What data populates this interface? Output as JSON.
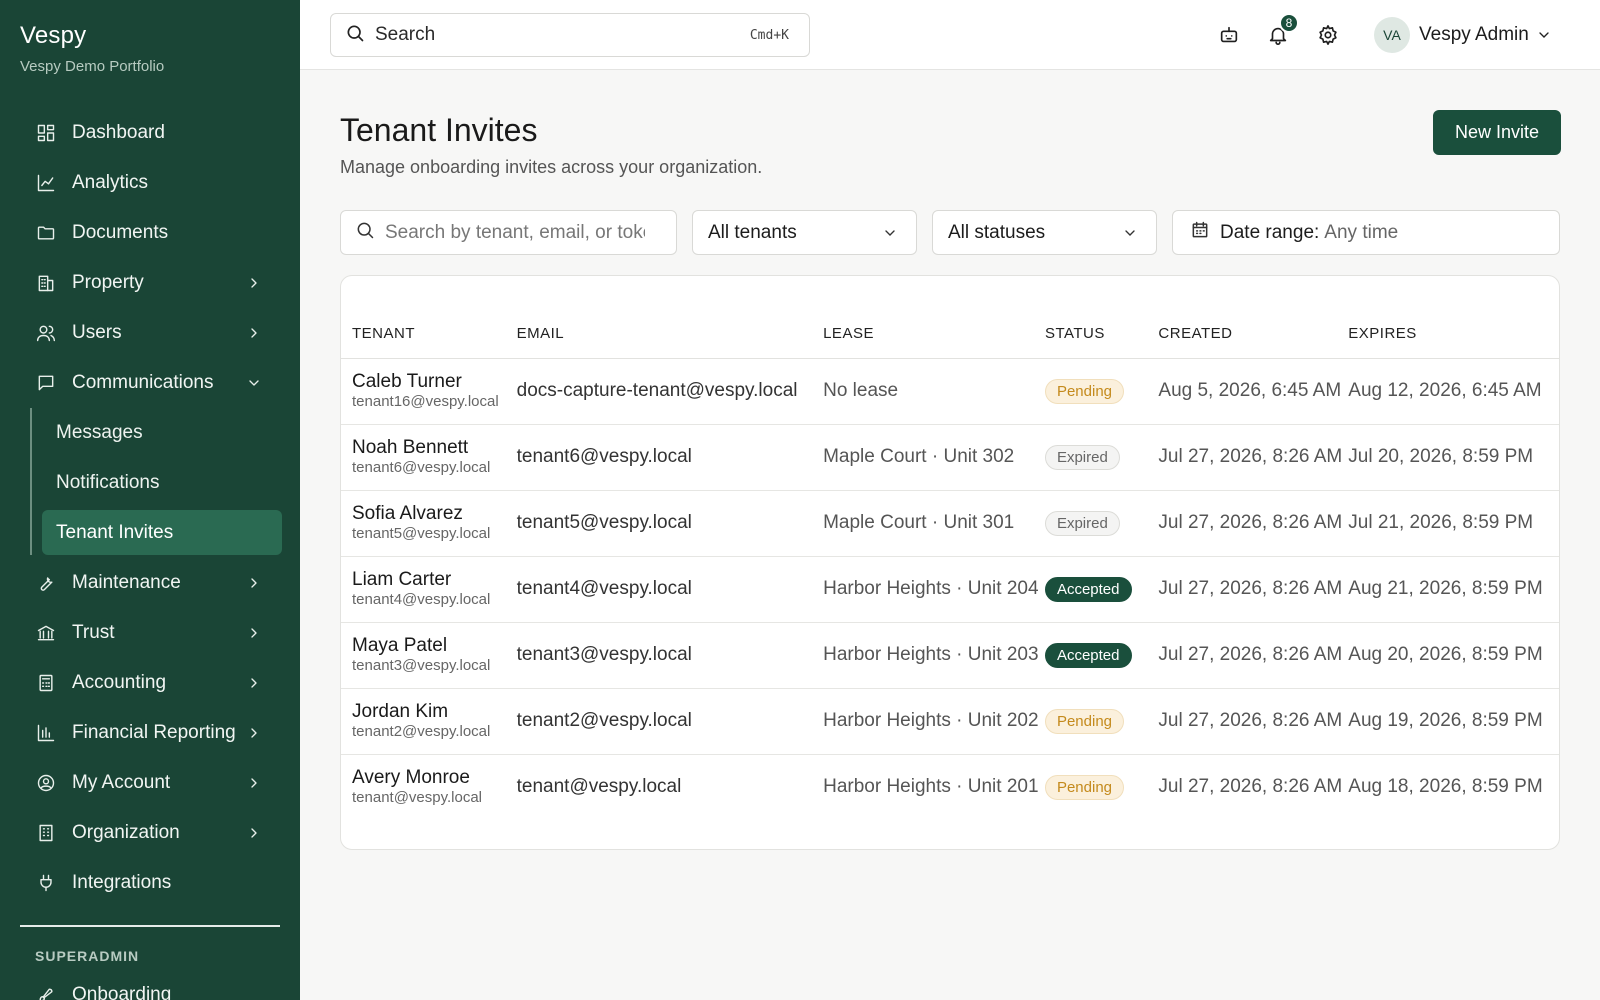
{
  "brand": {
    "name": "Vespy",
    "portfolio": "Vespy Demo Portfolio"
  },
  "sidebar": {
    "items": [
      {
        "label": "Dashboard",
        "icon": "dashboard-icon"
      },
      {
        "label": "Analytics",
        "icon": "chart-line-icon"
      },
      {
        "label": "Documents",
        "icon": "folder-icon"
      },
      {
        "label": "Property",
        "icon": "building-icon",
        "has_children": true
      },
      {
        "label": "Users",
        "icon": "users-icon",
        "has_children": true
      },
      {
        "label": "Communications",
        "icon": "message-square-icon",
        "expanded": true
      },
      {
        "label": "Maintenance",
        "icon": "wrench-icon",
        "has_children": true
      },
      {
        "label": "Trust",
        "icon": "bank-icon",
        "has_children": true
      },
      {
        "label": "Accounting",
        "icon": "calculator-icon",
        "has_children": true
      },
      {
        "label": "Financial Reporting",
        "icon": "bar-chart-icon",
        "has_children": true
      },
      {
        "label": "My Account",
        "icon": "user-circle-icon",
        "has_children": true
      },
      {
        "label": "Organization",
        "icon": "office-building-icon",
        "has_children": true
      },
      {
        "label": "Integrations",
        "icon": "plug-icon"
      }
    ],
    "communications_children": [
      {
        "label": "Messages"
      },
      {
        "label": "Notifications"
      },
      {
        "label": "Tenant Invites",
        "active": true
      }
    ],
    "section_label": "SUPERADMIN",
    "superadmin_items": [
      {
        "label": "Onboarding",
        "icon": "rocket-icon"
      }
    ]
  },
  "topbar": {
    "search_placeholder": "Search",
    "search_shortcut": "Cmd+K",
    "notification_count": "8",
    "user": {
      "initials": "VA",
      "name": "Vespy Admin"
    }
  },
  "page": {
    "title": "Tenant Invites",
    "subtitle": "Manage onboarding invites across your organization.",
    "new_invite_label": "New Invite"
  },
  "filters": {
    "search_placeholder": "Search by tenant, email, or token",
    "tenant_select": "All tenants",
    "status_select": "All statuses",
    "date_range_label": "Date range:",
    "date_range_value": "Any time"
  },
  "table": {
    "headers": [
      "TENANT",
      "EMAIL",
      "LEASE",
      "STATUS",
      "CREATED",
      "EXPIRES"
    ],
    "rows": [
      {
        "name": "Caleb Turner",
        "sub_email": "tenant16@vespy.local",
        "email": "docs-capture-tenant@vespy.local",
        "lease": "No lease",
        "status": "Pending",
        "status_kind": "pending",
        "created": "Aug 5, 2026, 6:45 AM",
        "expires": "Aug 12, 2026, 6:45 AM"
      },
      {
        "name": "Noah Bennett",
        "sub_email": "tenant6@vespy.local",
        "email": "tenant6@vespy.local",
        "lease": "Maple Court · Unit 302",
        "status": "Expired",
        "status_kind": "expired",
        "created": "Jul 27, 2026, 8:26 AM",
        "expires": "Jul 20, 2026, 8:59 PM"
      },
      {
        "name": "Sofia Alvarez",
        "sub_email": "tenant5@vespy.local",
        "email": "tenant5@vespy.local",
        "lease": "Maple Court · Unit 301",
        "status": "Expired",
        "status_kind": "expired",
        "created": "Jul 27, 2026, 8:26 AM",
        "expires": "Jul 21, 2026, 8:59 PM"
      },
      {
        "name": "Liam Carter",
        "sub_email": "tenant4@vespy.local",
        "email": "tenant4@vespy.local",
        "lease": "Harbor Heights · Unit 204",
        "status": "Accepted",
        "status_kind": "accepted",
        "created": "Jul 27, 2026, 8:26 AM",
        "expires": "Aug 21, 2026, 8:59 PM"
      },
      {
        "name": "Maya Patel",
        "sub_email": "tenant3@vespy.local",
        "email": "tenant3@vespy.local",
        "lease": "Harbor Heights · Unit 203",
        "status": "Accepted",
        "status_kind": "accepted",
        "created": "Jul 27, 2026, 8:26 AM",
        "expires": "Aug 20, 2026, 8:59 PM"
      },
      {
        "name": "Jordan Kim",
        "sub_email": "tenant2@vespy.local",
        "email": "tenant2@vespy.local",
        "lease": "Harbor Heights · Unit 202",
        "status": "Pending",
        "status_kind": "pending",
        "created": "Jul 27, 2026, 8:26 AM",
        "expires": "Aug 19, 2026, 8:59 PM"
      },
      {
        "name": "Avery Monroe",
        "sub_email": "tenant@vespy.local",
        "email": "tenant@vespy.local",
        "lease": "Harbor Heights · Unit 201",
        "status": "Pending",
        "status_kind": "pending",
        "created": "Jul 27, 2026, 8:26 AM",
        "expires": "Aug 18, 2026, 8:59 PM"
      }
    ]
  },
  "colors": {
    "sidebar_bg": "#1a4536",
    "accent": "#1a4f3c",
    "active_item": "#2a6a52",
    "pending": "#c48a1c"
  }
}
